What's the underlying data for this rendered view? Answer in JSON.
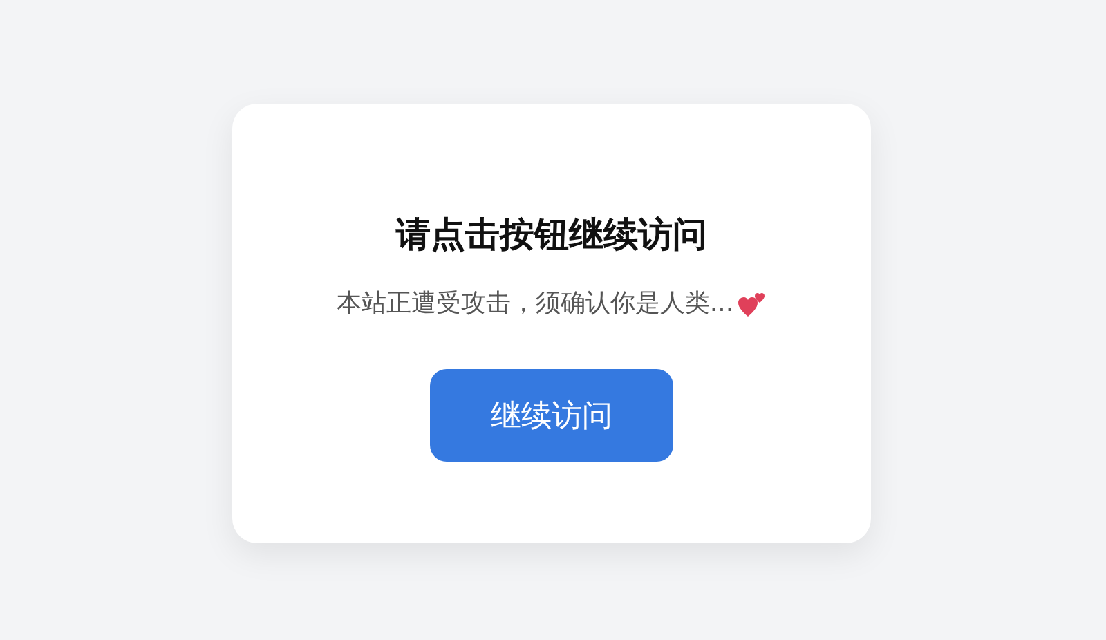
{
  "card": {
    "title": "请点击按钮继续访问",
    "message": "本站正遭受攻击，须确认你是人类...",
    "button": "继续访问"
  }
}
